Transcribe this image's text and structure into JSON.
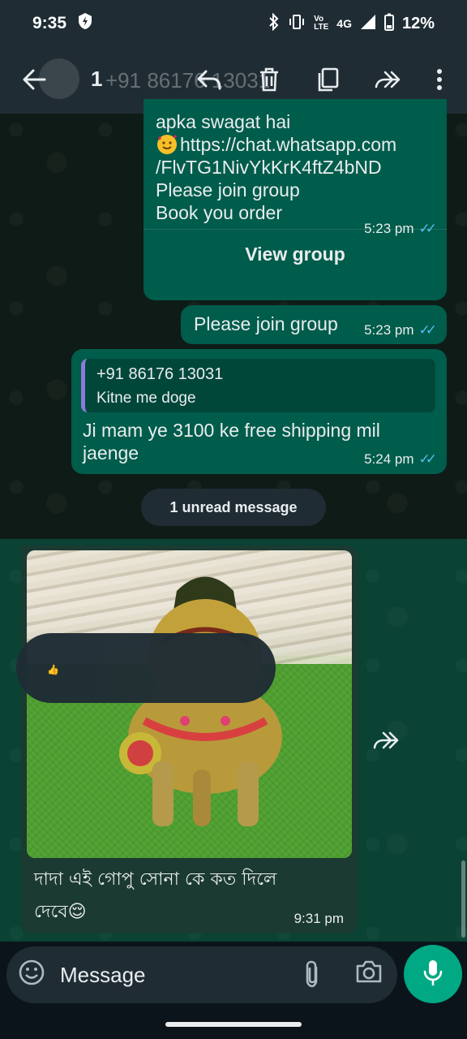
{
  "status_bar": {
    "time": "9:35",
    "network": "4G",
    "battery": "12%"
  },
  "header": {
    "selected_count": "1",
    "contact_ghost": "+91 86176 13031"
  },
  "messages": {
    "group_link": {
      "line1": "apka swagat hai",
      "line2": "https://chat.whatsapp.com",
      "line3": "/FlvTG1NivYkKrK4ftZ4bND",
      "line4": "Please join group",
      "line5": "Book you order",
      "time": "5:23 pm",
      "view_group": "View group"
    },
    "join": {
      "text": "Please join group",
      "time": "5:23 pm"
    },
    "reply": {
      "quote_name": "+91 86176 13031",
      "quote_text": "Kitne me doge",
      "line1": "Ji mam ye 3100 ke free shipping mil",
      "line2": "jaenge",
      "time": "5:24 pm"
    },
    "unread_label": "1 unread message",
    "incoming": {
      "caption_line1": "দাদা এই গোপু সোনা কে কত দিলে",
      "caption_line2": "দেবে😌",
      "time": "9:31 pm"
    }
  },
  "input": {
    "placeholder": "Message"
  },
  "colors": {
    "accent": "#00a884",
    "outgoing_bubble": "#005c4b",
    "incoming_bubble": "#1f2c34",
    "read_ticks": "#53bdeb"
  },
  "icons": [
    "back-arrow-icon",
    "reply-icon",
    "delete-icon",
    "copy-icon",
    "forward-icon",
    "more-options-icon",
    "emoji-icon",
    "attach-icon",
    "camera-icon",
    "mic-icon"
  ]
}
